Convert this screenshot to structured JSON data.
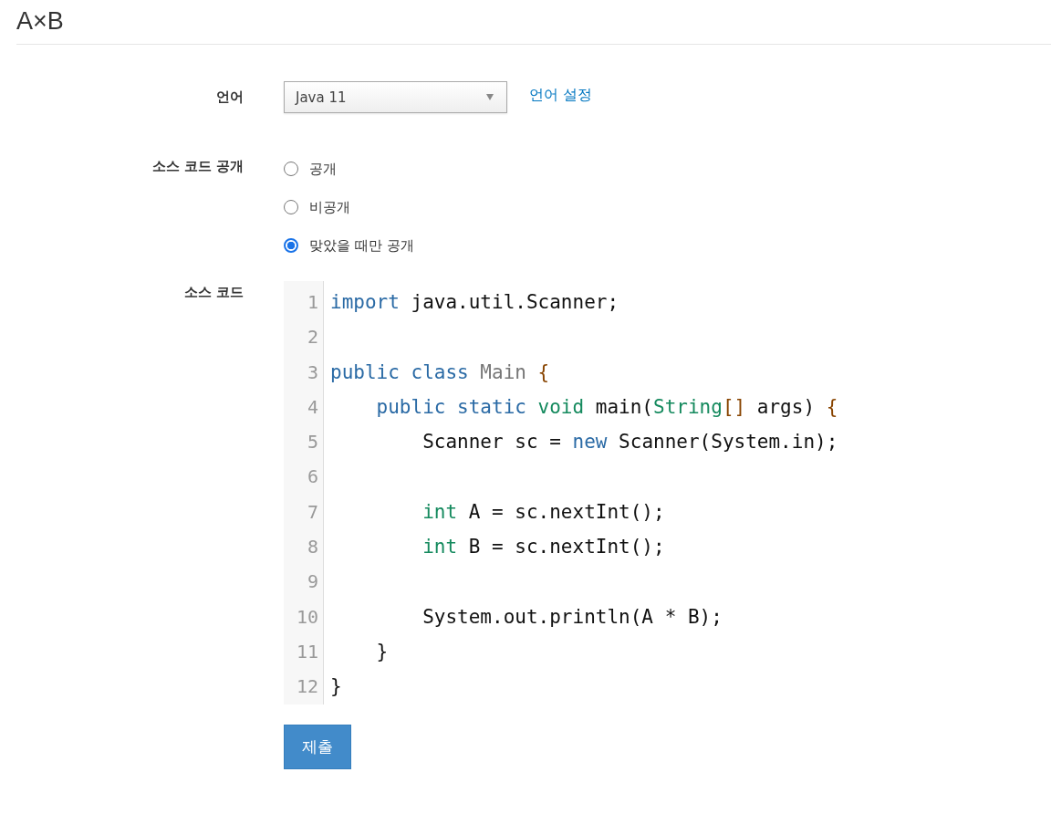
{
  "title": "A×B",
  "form": {
    "language": {
      "label": "언어",
      "value": "Java 11",
      "link": "언어 설정"
    },
    "visibility": {
      "label": "소스 코드 공개",
      "options": [
        {
          "label": "공개",
          "selected": false
        },
        {
          "label": "비공개",
          "selected": false
        },
        {
          "label": "맞았을 때만 공개",
          "selected": true
        }
      ]
    },
    "source": {
      "label": "소스 코드",
      "lines": [
        {
          "number": "1",
          "tokens": [
            {
              "text": "import",
              "kind": "keyword"
            },
            {
              "text": " java.util.Scanner;",
              "kind": "plain"
            }
          ]
        },
        {
          "number": "2"
        },
        {
          "number": "3",
          "tokens": [
            {
              "text": "public class",
              "kind": "keyword"
            },
            {
              "text": " Main",
              "kind": "def"
            },
            {
              "text": " {",
              "kind": "bracket"
            }
          ]
        },
        {
          "number": "4",
          "tokens": [
            {
              "text": "    public static",
              "kind": "keyword"
            },
            {
              "text": " void",
              "kind": "type"
            },
            {
              "text": " main(",
              "kind": "plain"
            },
            {
              "text": "String",
              "kind": "type"
            },
            {
              "text": "[]",
              "kind": "bracket"
            },
            {
              "text": " args)",
              "kind": "plain"
            },
            {
              "text": " {",
              "kind": "bracket"
            }
          ]
        },
        {
          "number": "5",
          "tokens": [
            {
              "text": "        Scanner sc = ",
              "kind": "plain"
            },
            {
              "text": "new",
              "kind": "keyword"
            },
            {
              "text": " Scanner(System.in);",
              "kind": "plain"
            }
          ]
        },
        {
          "number": "6"
        },
        {
          "number": "7",
          "tokens": [
            {
              "text": "        int",
              "kind": "type"
            },
            {
              "text": " A = sc.nextInt();",
              "kind": "plain"
            }
          ]
        },
        {
          "number": "8",
          "tokens": [
            {
              "text": "        int",
              "kind": "type"
            },
            {
              "text": " B = sc.nextInt();",
              "kind": "plain"
            }
          ]
        },
        {
          "number": "9"
        },
        {
          "number": "10",
          "tokens": [
            {
              "text": "        System.out.println(A * B);",
              "kind": "plain"
            }
          ]
        },
        {
          "number": "11",
          "tokens": [
            {
              "text": "    }",
              "kind": "plain"
            }
          ]
        },
        {
          "number": "12",
          "tokens": [
            {
              "text": "}",
              "kind": "plain"
            }
          ]
        }
      ]
    },
    "submit": "제출"
  }
}
